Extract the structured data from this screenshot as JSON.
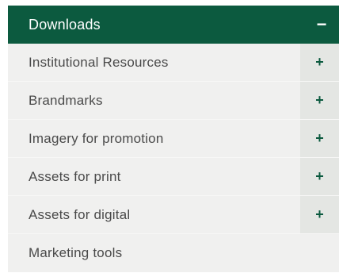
{
  "accordion": {
    "title": "Downloads",
    "toggle": "−",
    "items": [
      {
        "label": "Institutional Resources",
        "toggle": "+"
      },
      {
        "label": "Brandmarks",
        "toggle": "+"
      },
      {
        "label": "Imagery for promotion",
        "toggle": "+"
      },
      {
        "label": "Assets for print",
        "toggle": "+"
      },
      {
        "label": "Assets for digital",
        "toggle": "+"
      },
      {
        "label": "Marketing tools"
      }
    ]
  },
  "colors": {
    "header_bg": "#0c5a3f",
    "list_bg": "#f0f0ef",
    "toggle_bg": "#e4e6e3",
    "plus_color": "#0c5a3f",
    "text_color": "#4a4a4a"
  }
}
